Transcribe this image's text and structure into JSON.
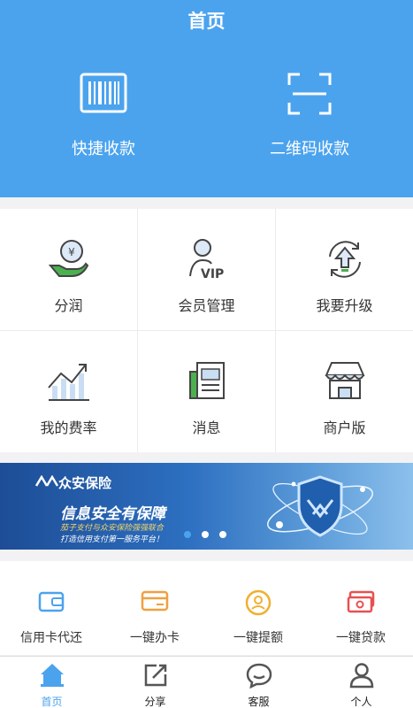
{
  "header": {
    "title": "首页",
    "quick_pay_label": "快捷收款",
    "qr_pay_label": "二维码收款"
  },
  "grid": [
    {
      "label": "分润",
      "icon": "profit-share-icon"
    },
    {
      "label": "会员管理",
      "icon": "vip-member-icon"
    },
    {
      "label": "我要升级",
      "icon": "upgrade-icon"
    },
    {
      "label": "我的费率",
      "icon": "rate-chart-icon"
    },
    {
      "label": "消息",
      "icon": "message-icon"
    },
    {
      "label": "商户版",
      "icon": "store-icon"
    }
  ],
  "banner": {
    "brand": "众安保险",
    "slogan": "信息安全有保障",
    "subtitle1": "茄子支付与众安保险强强联合",
    "subtitle2": "打造信用支付第一服务平台！",
    "dots": 3,
    "active_dot": 0
  },
  "services": [
    {
      "label": "信用卡代还",
      "icon": "wallet-icon",
      "color": "#4ba3ee"
    },
    {
      "label": "一键办卡",
      "icon": "credit-card-icon",
      "color": "#f0a040"
    },
    {
      "label": "一键提额",
      "icon": "limit-increase-icon",
      "color": "#f0b030"
    },
    {
      "label": "一键贷款",
      "icon": "loan-icon",
      "color": "#e85050"
    }
  ],
  "tabbar": {
    "tabs": [
      {
        "label": "首页",
        "icon": "home-icon",
        "active": true
      },
      {
        "label": "分享",
        "icon": "share-icon",
        "active": false
      },
      {
        "label": "客服",
        "icon": "customer-service-icon",
        "active": false
      },
      {
        "label": "个人",
        "icon": "person-icon",
        "active": false
      }
    ]
  },
  "colors": {
    "primary": "#4ba3ee",
    "background": "#f2f2f4"
  }
}
